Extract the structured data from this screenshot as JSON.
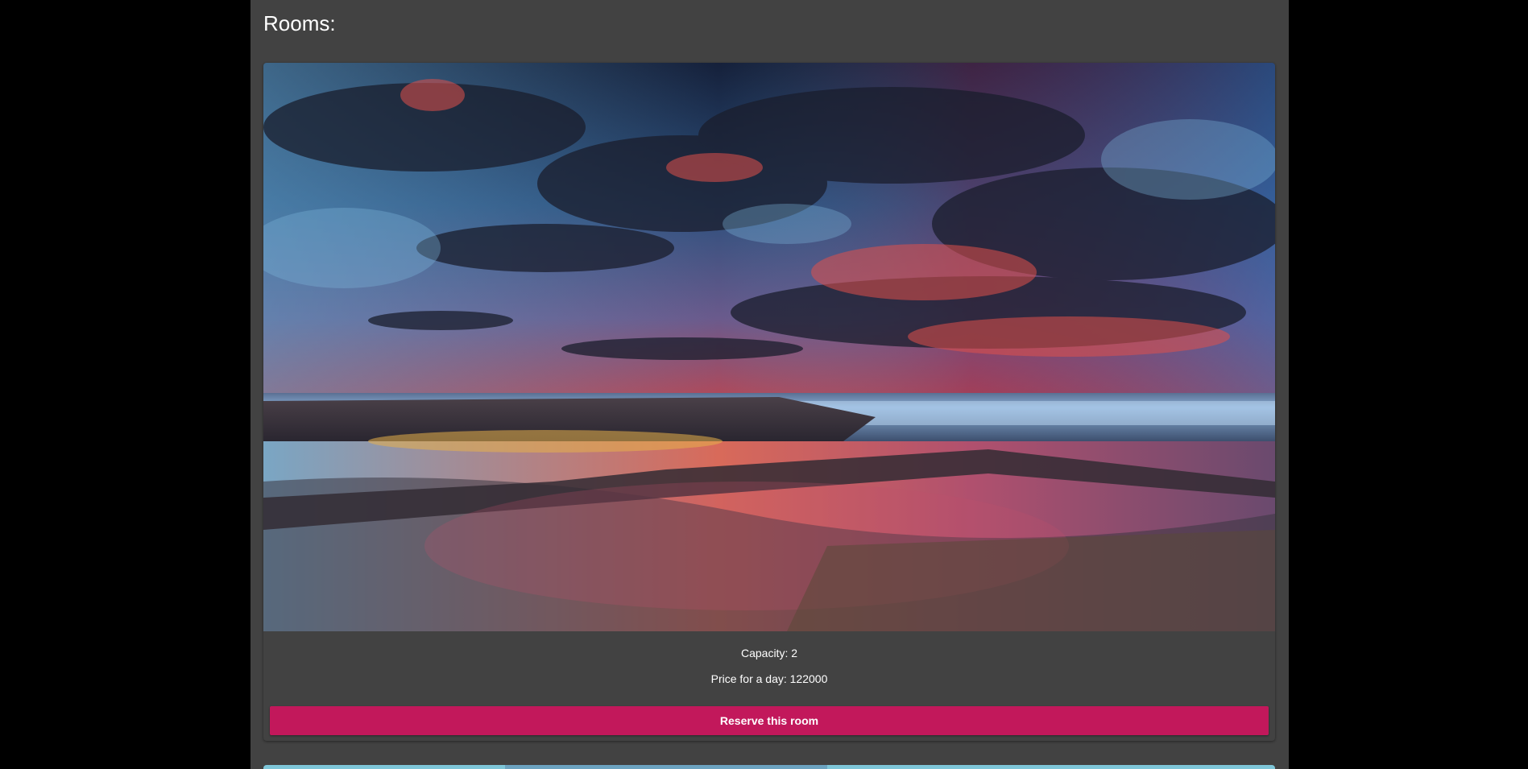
{
  "page": {
    "title": "Rooms:"
  },
  "rooms": [
    {
      "capacity_label": "Capacity: 2",
      "price_label": "Price for a day: 122000",
      "reserve_label": "Reserve this room"
    }
  ],
  "colors": {
    "page_background": "#000000",
    "container_background": "#424242",
    "button_background": "#c2185b",
    "text": "#ffffff"
  }
}
